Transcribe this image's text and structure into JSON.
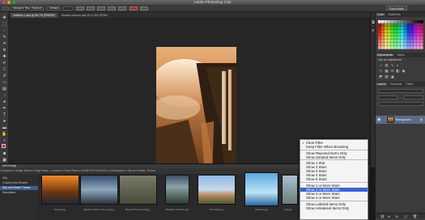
{
  "window": {
    "title": "Adobe Photoshop CS6"
  },
  "options_bar": {
    "mode": "Marquee Pin",
    "tolerance": "Replace",
    "fill": "Default",
    "essentials": "Essentials"
  },
  "doc_tabs": [
    {
      "label": "Untitled-1.psd @ 66.7% (RGB/8*)"
    },
    {
      "label": "Mosaic autumn.psd @ 12.5% (RGB/8)"
    }
  ],
  "right_panel": {
    "top_tabs": [
      "Color",
      "Swatches"
    ],
    "mid_tabs": [
      "Adjustments",
      "Styles"
    ],
    "mid_caption": "Add an adjustment",
    "layer_tabs": [
      "Layers",
      "Channels",
      "Paths"
    ],
    "layer_name": "Background"
  },
  "bridge": {
    "title": "Mini Bridge",
    "path": "Computer  ▸  Image Bank  ▸  Image Bank - Locked  ▸  Photo Batch  ▸  RANDOM IMAGES  ▸  Landscapes  ▸  Sky and Water Thems",
    "sidebar": [
      "City",
      "Country and Shores",
      "Sky and Water Thems",
      "Mountains"
    ],
    "selected_sidebar": "Sky and Water Thems",
    "thumbs": [
      {
        "label": "Sunset.jpg"
      },
      {
        "label": "Wooden shore in the city.jpg"
      },
      {
        "label": "Beyond the forests.jpg"
      },
      {
        "label": "Weather at Rome.jpg"
      },
      {
        "label": "Tree field.jpg"
      },
      {
        "label": "Glaciers.jpg"
      },
      {
        "label": "City.jpg"
      }
    ]
  },
  "filter_menu": {
    "items": [
      {
        "label": "Clear Filter",
        "checked": true
      },
      {
        "label": "Keep Filter When Browsing",
        "checked": false
      },
      {
        "sep": true
      },
      {
        "label": "Show Rejected Items Only",
        "checked": false
      },
      {
        "label": "Show Unrated Items Only",
        "checked": false
      },
      {
        "sep": true
      },
      {
        "label": "Show 1 Star",
        "checked": false
      },
      {
        "label": "Show 2 Stars",
        "checked": false
      },
      {
        "label": "Show 3 Stars",
        "checked": false
      },
      {
        "label": "Show 4 Stars",
        "checked": false
      },
      {
        "label": "Show 5 Stars",
        "checked": false
      },
      {
        "sep": true
      },
      {
        "label": "Show 1 or More Stars",
        "checked": false
      },
      {
        "label": "Show 2 or More Stars",
        "checked": false,
        "selected": true
      },
      {
        "label": "Show 3 or More Stars",
        "checked": false
      },
      {
        "label": "Show 4 or More Stars",
        "checked": false
      },
      {
        "sep": true
      },
      {
        "label": "Show Labeled Items Only",
        "checked": false
      },
      {
        "label": "Show Unlabeled Items Only",
        "checked": false
      }
    ]
  },
  "colors": {
    "accent": "#3b64d3",
    "foreground": "#cc2222",
    "layer_selected": "#5a6b8a"
  }
}
